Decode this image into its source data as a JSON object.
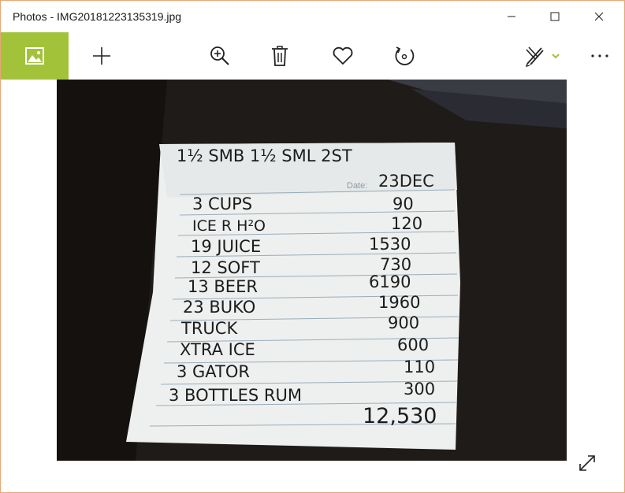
{
  "window": {
    "title": "Photos - IMG20181223135319.jpg",
    "accent_color": "#a2c23a"
  },
  "titlebar_controls": [
    "minimize-icon",
    "maximize-icon",
    "close-icon"
  ],
  "toolbar": {
    "buttons": [
      "view-photo-icon",
      "add-icon",
      "zoom-in-icon",
      "delete-icon",
      "favorite-heart-icon",
      "rotate-icon",
      "edit-create-icon",
      "more-options-icon"
    ]
  },
  "photo": {
    "header": "1½ SMB 1½ SML 2ST",
    "date_label": "Date:",
    "date_value": "23DEC",
    "rows": [
      {
        "item": "3 CUPS",
        "amount": "90"
      },
      {
        "item": "ICE R H²O",
        "amount": "120"
      },
      {
        "item": "19 JUICE",
        "amount": "1530"
      },
      {
        "item": "12 SOFT",
        "amount": "730"
      },
      {
        "item": "13 BEER",
        "amount": "6190"
      },
      {
        "item": "23 BUKO",
        "amount": "1960"
      },
      {
        "item": "TRUCK",
        "amount": "900"
      },
      {
        "item": "XTRA ICE",
        "amount": "600"
      },
      {
        "item": "3 GATOR",
        "amount": "110"
      },
      {
        "item": "3 BOTTLES RUM",
        "amount": "300"
      }
    ],
    "total": "12,530"
  }
}
